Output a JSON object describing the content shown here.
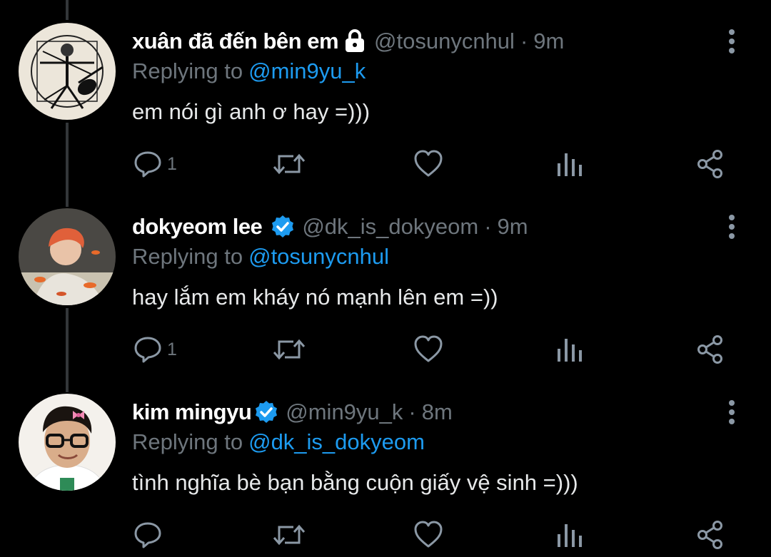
{
  "colors": {
    "background": "#000000",
    "secondary_text": "#6e767d",
    "link": "#1d9bf0",
    "verified": "#1d9bf0",
    "icon": "#8b98a5"
  },
  "tweets": [
    {
      "display_name": "xuân đã đến bên em",
      "badge": "lock-icon",
      "handle": "@tosunycnhul",
      "separator": "·",
      "time": "9m",
      "replying_label": "Replying to",
      "replying_to": "@min9yu_k",
      "text": "em nói gì anh ơ hay =)))",
      "reply_count": "1",
      "avatar": "vitruvian-guitar-avatar"
    },
    {
      "display_name": "dokyeom lee",
      "badge": "verified-icon",
      "handle": "@dk_is_dokyeom",
      "separator": "·",
      "time": "9m",
      "replying_label": "Replying to",
      "replying_to": "@tosunycnhul",
      "text": "hay lắm em kháy nó mạnh lên em =))",
      "reply_count": "1",
      "avatar": "red-hair-goldfish-avatar"
    },
    {
      "display_name": "kim mingyu",
      "badge": "verified-icon",
      "handle": "@min9yu_k",
      "separator": "·",
      "time": "8m",
      "replying_label": "Replying to",
      "replying_to": "@dk_is_dokyeom",
      "text": "tình nghĩa bè bạn bằng cuộn giấy vệ sinh =)))",
      "reply_count": "",
      "avatar": "glasses-bow-avatar"
    }
  ]
}
